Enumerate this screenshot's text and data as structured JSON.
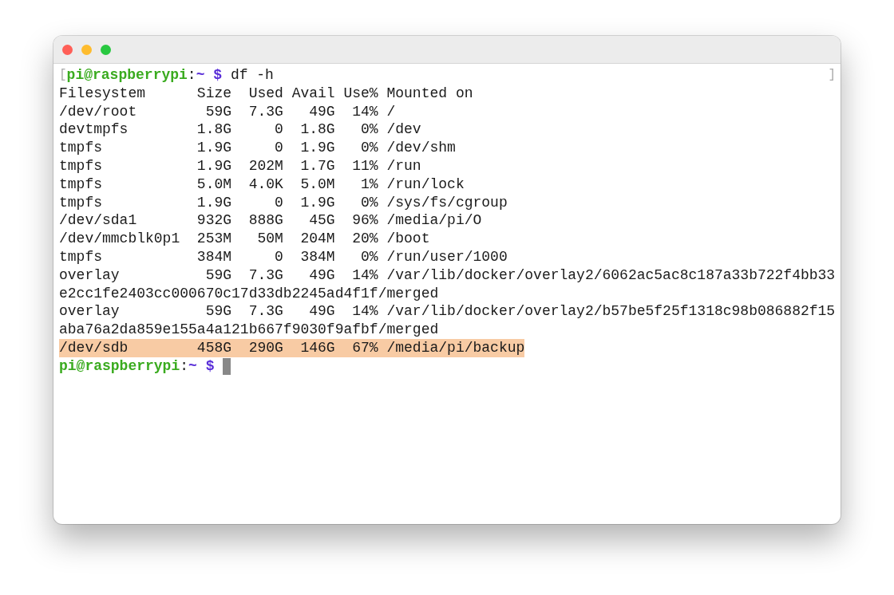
{
  "window": {
    "buttons": [
      {
        "color": "#ff5f57"
      },
      {
        "color": "#febc2e"
      },
      {
        "color": "#28c840"
      }
    ]
  },
  "terminal": {
    "lines": [
      {
        "kind": "prompt",
        "mark_open": "[",
        "user": "pi@raspberrypi",
        "separator": ":",
        "path": "~",
        "symbol": "$",
        "command": "df -h",
        "mark_close": "]"
      },
      {
        "kind": "output",
        "text": "Filesystem      Size  Used Avail Use% Mounted on",
        "highlighted": false
      },
      {
        "kind": "output",
        "text": "/dev/root        59G  7.3G   49G  14% /",
        "highlighted": false
      },
      {
        "kind": "output",
        "text": "devtmpfs        1.8G     0  1.8G   0% /dev",
        "highlighted": false
      },
      {
        "kind": "output",
        "text": "tmpfs           1.9G     0  1.9G   0% /dev/shm",
        "highlighted": false
      },
      {
        "kind": "output",
        "text": "tmpfs           1.9G  202M  1.7G  11% /run",
        "highlighted": false
      },
      {
        "kind": "output",
        "text": "tmpfs           5.0M  4.0K  5.0M   1% /run/lock",
        "highlighted": false
      },
      {
        "kind": "output",
        "text": "tmpfs           1.9G     0  1.9G   0% /sys/fs/cgroup",
        "highlighted": false
      },
      {
        "kind": "output",
        "text": "/dev/sda1       932G  888G   45G  96% /media/pi/O",
        "highlighted": false
      },
      {
        "kind": "output",
        "text": "/dev/mmcblk0p1  253M   50M  204M  20% /boot",
        "highlighted": false
      },
      {
        "kind": "output",
        "text": "tmpfs           384M     0  384M   0% /run/user/1000",
        "highlighted": false
      },
      {
        "kind": "output",
        "text": "overlay          59G  7.3G   49G  14% /var/lib/docker/overlay2/6062ac5ac8c187a33b722f4bb33",
        "highlighted": false
      },
      {
        "kind": "output",
        "text": "e2cc1fe2403cc000670c17d33db2245ad4f1f/merged",
        "highlighted": false
      },
      {
        "kind": "output",
        "text": "overlay          59G  7.3G   49G  14% /var/lib/docker/overlay2/b57be5f25f1318c98b086882f15",
        "highlighted": false
      },
      {
        "kind": "output",
        "text": "aba76a2da859e155a4a121b667f9030f9afbf/merged",
        "highlighted": false
      },
      {
        "kind": "output",
        "text": "/dev/sdb        458G  290G  146G  67% /media/pi/backup",
        "highlighted": true
      },
      {
        "kind": "prompt",
        "user": "pi@raspberrypi",
        "separator": ":",
        "path": "~",
        "symbol": "$",
        "cursor": true
      }
    ]
  }
}
